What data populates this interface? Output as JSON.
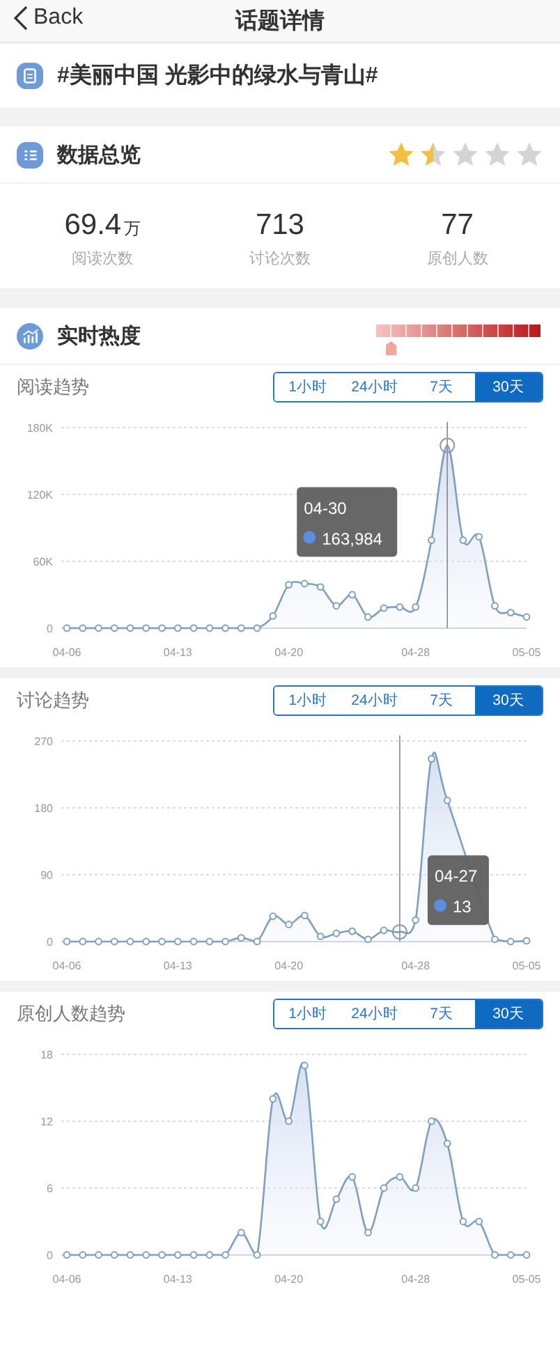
{
  "nav": {
    "back": "Back",
    "title": "话题详情"
  },
  "topic": {
    "title": "#美丽中国 光影中的绿水与青山#"
  },
  "overview": {
    "title": "数据总览",
    "stars": 1.5,
    "stats": [
      {
        "value": "69.4",
        "unit": "万",
        "label": "阅读次数"
      },
      {
        "value": "713",
        "label": "讨论次数"
      },
      {
        "value": "77",
        "label": "原创人数"
      }
    ]
  },
  "heat": {
    "title": "实时热度"
  },
  "charts": [
    {
      "title": "阅读趋势",
      "tabs": [
        {
          "label": "1小时",
          "selected": false
        },
        {
          "label": "24小时",
          "selected": false
        },
        {
          "label": "7天",
          "selected": false
        },
        {
          "label": "30天",
          "selected": true
        }
      ],
      "tooltip": {
        "date": "04-30"
      },
      "points": [
        {
          "selected": false
        },
        {
          "selected": false
        },
        {
          "selected": false
        },
        {
          "selected": false
        },
        {
          "selected": false
        },
        {
          "selected": false
        },
        {
          "selected": false
        },
        {
          "selected": false
        },
        {
          "selected": false
        },
        {
          "selected": false
        },
        {
          "selected": false
        },
        {
          "selected": false
        },
        {
          "selected": false
        },
        {
          "selected": false
        },
        {
          "selected": false
        },
        {
          "selected": false
        },
        {
          "selected": false
        },
        {
          "selected": false
        },
        {
          "selected": false
        },
        {
          "selected": false
        },
        {
          "selected": false
        },
        {
          "selected": false
        },
        {
          "selected": false
        },
        {
          "selected": false
        },
        {
          "selected": true
        },
        {
          "selected": false
        },
        {
          "selected": false
        },
        {
          "selected": false
        },
        {
          "selected": false
        },
        {
          "selected": false
        }
      ],
      "chart_data": {
        "type": "area",
        "categories": [
          "04-06",
          null,
          null,
          null,
          null,
          null,
          null,
          "04-13",
          null,
          null,
          null,
          null,
          null,
          null,
          "04-20",
          null,
          null,
          null,
          null,
          null,
          null,
          null,
          "04-28",
          null,
          null,
          null,
          null,
          null,
          null,
          "05-05"
        ],
        "yticks": [
          {
            "value": 0,
            "label": "0"
          },
          {
            "value": 60000,
            "label": "60K"
          },
          {
            "value": 120000,
            "label": "120K"
          },
          {
            "value": 180000,
            "label": "180K"
          }
        ],
        "ylim": [
          0,
          180000
        ],
        "series": [
          {
            "color": "#7f9fc0",
            "values": [
              0,
              0,
              0,
              0,
              0,
              0,
              0,
              0,
              0,
              0,
              0,
              0,
              0,
              11000,
              39000,
              40000,
              37000,
              20000,
              30000,
              10000,
              18000,
              19000,
              19000,
              79000,
              164000,
              79000,
              82000,
              20000,
              14000,
              10000
            ]
          }
        ],
        "annotations": [
          "163,984"
        ]
      }
    },
    {
      "title": "讨论趋势",
      "tabs": [
        {
          "label": "1小时",
          "selected": false
        },
        {
          "label": "24小时",
          "selected": false
        },
        {
          "label": "7天",
          "selected": false
        },
        {
          "label": "30天",
          "selected": true
        }
      ],
      "tooltip": {
        "date": "04-27"
      },
      "points": [
        {
          "selected": false
        },
        {
          "selected": false
        },
        {
          "selected": false
        },
        {
          "selected": false
        },
        {
          "selected": false
        },
        {
          "selected": false
        },
        {
          "selected": false
        },
        {
          "selected": false
        },
        {
          "selected": false
        },
        {
          "selected": false
        },
        {
          "selected": false
        },
        {
          "selected": false
        },
        {
          "selected": false
        },
        {
          "selected": false
        },
        {
          "selected": false
        },
        {
          "selected": false
        },
        {
          "selected": false
        },
        {
          "selected": false
        },
        {
          "selected": false
        },
        {
          "selected": false
        },
        {
          "selected": false
        },
        {
          "selected": true
        },
        {
          "selected": false
        },
        {
          "selected": false
        },
        {
          "selected": false
        },
        {
          "selected": false
        },
        {
          "selected": false
        },
        {
          "selected": false
        },
        {
          "selected": false
        },
        {
          "selected": false
        }
      ],
      "chart_data": {
        "type": "area",
        "categories": [
          "04-06",
          null,
          null,
          null,
          null,
          null,
          null,
          "04-13",
          null,
          null,
          null,
          null,
          null,
          null,
          "04-20",
          null,
          null,
          null,
          null,
          null,
          null,
          null,
          "04-28",
          null,
          null,
          null,
          null,
          null,
          null,
          "05-05"
        ],
        "yticks": [
          {
            "value": 0,
            "label": "0"
          },
          {
            "value": 90,
            "label": "90"
          },
          {
            "value": 180,
            "label": "180"
          },
          {
            "value": 270,
            "label": "270"
          }
        ],
        "ylim": [
          0,
          270
        ],
        "series": [
          {
            "color": "#7f9fc0",
            "values": [
              0,
              0,
              0,
              0,
              0,
              0,
              0,
              0,
              0,
              0,
              0,
              5,
              0,
              34,
              23,
              35,
              7,
              11,
              14,
              3,
              15,
              13,
              29,
              246,
              190,
              null,
              null,
              3,
              0,
              1
            ]
          }
        ],
        "annotations": [
          "13"
        ]
      }
    },
    {
      "title": "原创人数趋势",
      "tabs": [
        {
          "label": "1小时",
          "selected": false
        },
        {
          "label": "24小时",
          "selected": false
        },
        {
          "label": "7天",
          "selected": false
        },
        {
          "label": "30天",
          "selected": true
        }
      ],
      "chart_data": {
        "type": "area",
        "categories": [
          "04-06",
          null,
          null,
          null,
          null,
          null,
          null,
          "04-13",
          null,
          null,
          null,
          null,
          null,
          null,
          "04-20",
          null,
          null,
          null,
          null,
          null,
          null,
          null,
          "04-28",
          null,
          null,
          null,
          null,
          null,
          null,
          "05-05"
        ],
        "yticks": [
          {
            "value": 0,
            "label": "0"
          },
          {
            "value": 6,
            "label": "6"
          },
          {
            "value": 12,
            "label": "12"
          },
          {
            "value": 18,
            "label": "18"
          }
        ],
        "ylim": [
          0,
          18
        ],
        "series": [
          {
            "color": "#7f9fc0",
            "values": [
              0,
              0,
              0,
              0,
              0,
              0,
              0,
              0,
              0,
              0,
              0,
              2,
              0,
              14,
              12,
              17,
              3,
              5,
              7,
              2,
              6,
              7,
              6,
              12,
              10,
              3,
              3,
              0,
              0,
              0
            ]
          }
        ]
      }
    }
  ]
}
